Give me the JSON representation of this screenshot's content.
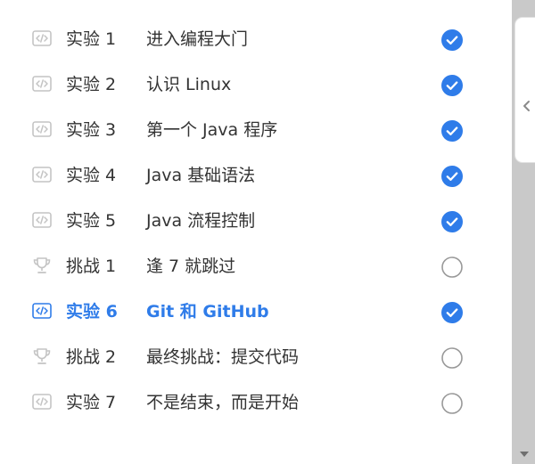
{
  "items": [
    {
      "kind": "实验 1",
      "title": "进入编程大门",
      "type": "lab",
      "done": true
    },
    {
      "kind": "实验 2",
      "title": "认识 Linux",
      "type": "lab",
      "done": true
    },
    {
      "kind": "实验 3",
      "title": "第一个 Java 程序",
      "type": "lab",
      "done": true
    },
    {
      "kind": "实验 4",
      "title": "Java 基础语法",
      "type": "lab",
      "done": true
    },
    {
      "kind": "实验 5",
      "title": "Java 流程控制",
      "type": "lab",
      "done": true
    },
    {
      "kind": "挑战 1",
      "title": "逢 7 就跳过",
      "type": "challenge",
      "done": false
    },
    {
      "kind": "实验 6",
      "title": "Git 和 GitHub",
      "type": "lab",
      "done": true,
      "active": true
    },
    {
      "kind": "挑战 2",
      "title": "最终挑战：提交代码",
      "type": "challenge",
      "done": false
    },
    {
      "kind": "实验 7",
      "title": "不是结束，而是开始",
      "type": "lab",
      "done": false
    }
  ],
  "icons": {
    "lab": "code-icon",
    "challenge": "trophy-icon",
    "done": "check-circle-icon",
    "not_done": "empty-circle-icon",
    "collapse": "chevron-left-icon",
    "scroll_down": "arrow-down-icon"
  },
  "colors": {
    "accent": "#2f7ce9",
    "text": "#333333",
    "muted_icon": "#c4c4c4",
    "circle_outline": "#999999",
    "scrollbar_track": "#c9c9c9"
  }
}
